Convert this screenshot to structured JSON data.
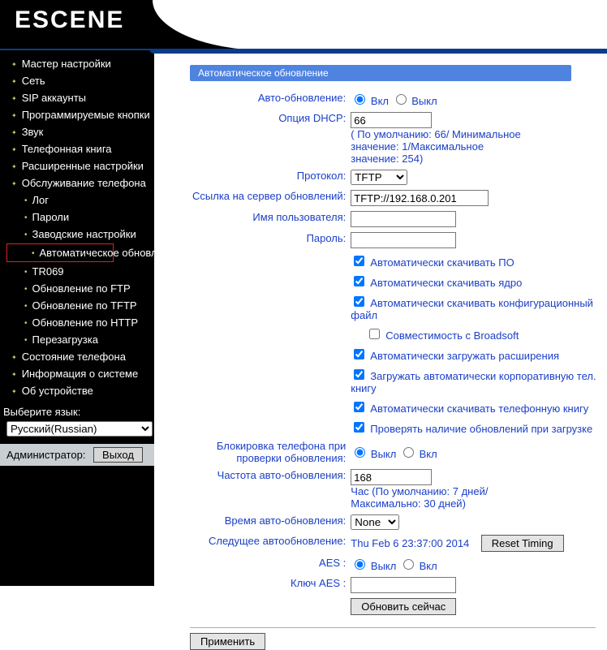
{
  "logo_text": "ESCENE",
  "sidebar": {
    "items": [
      "Мастер настройки",
      "Сеть",
      "SIP аккаунты",
      "Программируемые кнопки",
      "Звук",
      "Телефонная книга",
      "Расширенные настройки",
      "Обслуживание телефона",
      "Состояние телефона",
      "Информация о системе",
      "Об устройстве"
    ],
    "sub": [
      "Лог",
      "Пароли",
      "Заводские настройки",
      "Автоматическое обновление",
      "TR069",
      "Обновление по FTP",
      "Обновление по TFTP",
      "Обновление по HTTP",
      "Перезагрузка"
    ],
    "lang_label": "Выберите язык:",
    "lang_value": "Русский(Russian)",
    "admin_label": "Администратор:",
    "logout": "Выход"
  },
  "panel": {
    "title": "Автоматическое обновление",
    "auto_update_lbl": "Авто-обновление:",
    "on": "Вкл",
    "off": "Выкл",
    "dhcp_lbl": "Опция DHCP:",
    "dhcp_val": "66",
    "dhcp_hint": "( По умолчанию: 66/ Минимальное значение: 1/Максимальное значение: 254)",
    "proto_lbl": "Протокол:",
    "proto_val": "TFTP",
    "server_lbl": "Ссылка на сервер обновлений:",
    "server_val": "TFTP://192.168.0.201",
    "user_lbl": "Имя пользователя:",
    "user_val": "",
    "pass_lbl": "Пароль:",
    "pass_val": "",
    "cb_sw": "Автоматически скачивать ПО",
    "cb_kernel": "Автоматически скачивать ядро",
    "cb_cfg": "Автоматически скачивать конфигурационный файл",
    "cb_broadsoft": "Совместимость с Broadsoft",
    "cb_ext": "Автоматически загружать расширения",
    "cb_corp": "Загружать автоматически корпоративную тел. книгу",
    "cb_book": "Автоматически скачивать телефонную книгу",
    "cb_boot": "Проверять наличие обновлений при загрузке",
    "lock_lbl": "Блокировка телефона при проверки обновления:",
    "freq_lbl": "Частота авто-обновления:",
    "freq_val": "168",
    "freq_hint": "Час (По умолчанию: 7 дней/ Максимально: 30 дней)",
    "time_lbl": "Время авто-обновления:",
    "time_val": "None",
    "next_lbl": "Следущее автообновление:",
    "next_val": "Thu Feb 6 23:37:00 2014",
    "reset_timing": "Reset Timing",
    "aes_lbl": "AES :",
    "aeskey_lbl": "Ключ AES :",
    "aeskey_val": "",
    "update_now": "Обновить сейчас",
    "apply": "Применить"
  }
}
